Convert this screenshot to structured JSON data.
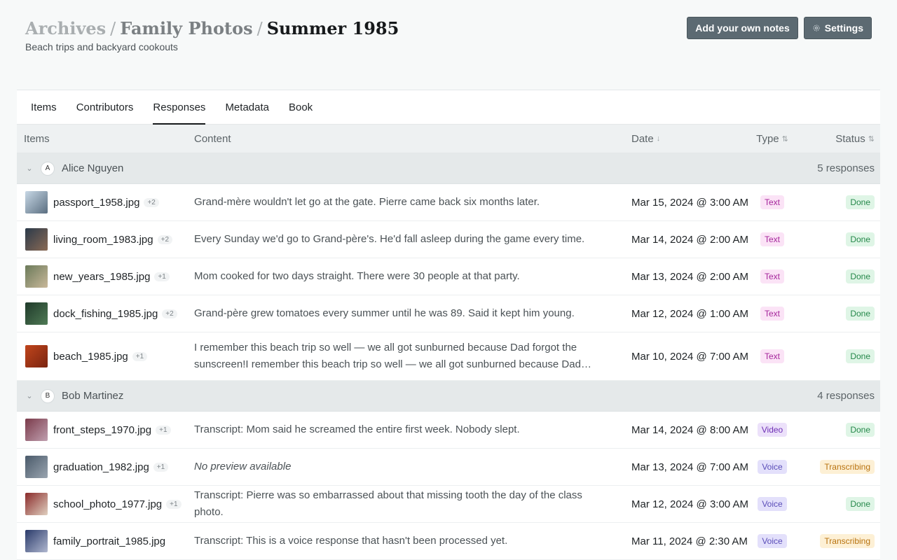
{
  "breadcrumb": {
    "level1": "Archives",
    "level2": "Family Photos",
    "level3": "Summer 1985",
    "separator": "/"
  },
  "subtitle": "Beach trips and backyard cookouts",
  "actions": {
    "notes_label": "Add your own notes",
    "settings_label": "Settings"
  },
  "tabs": [
    {
      "label": "Items",
      "active": false
    },
    {
      "label": "Contributors",
      "active": false
    },
    {
      "label": "Responses",
      "active": true
    },
    {
      "label": "Metadata",
      "active": false
    },
    {
      "label": "Book",
      "active": false
    }
  ],
  "columns": {
    "items": "Items",
    "content": "Content",
    "date": "Date",
    "type": "Type",
    "status": "Status"
  },
  "groups": [
    {
      "initial": "A",
      "name": "Alice Nguyen",
      "count": "5 responses",
      "rows": [
        {
          "file": "passport_1958.jpg",
          "extra": "+2",
          "content": "Grand-mère wouldn't let go at the gate. Pierre came back six months later.",
          "date": "Mar 15, 2024 @ 3:00 AM",
          "type": "Text",
          "status": "Done",
          "thumb": [
            "#c8d8e6",
            "#5a6e80"
          ]
        },
        {
          "file": "living_room_1983.jpg",
          "extra": "+2",
          "content": "Every Sunday we'd go to Grand-père's. He'd fall asleep during the game every time.",
          "date": "Mar 14, 2024 @ 2:00 AM",
          "type": "Text",
          "status": "Done",
          "thumb": [
            "#2b3a4a",
            "#8a6a55"
          ]
        },
        {
          "file": "new_years_1985.jpg",
          "extra": "+1",
          "content": "Mom cooked for two days straight. There were 30 people at that party.",
          "date": "Mar 13, 2024 @ 2:00 AM",
          "type": "Text",
          "status": "Done",
          "thumb": [
            "#6b7a5a",
            "#c9b89a"
          ]
        },
        {
          "file": "dock_fishing_1985.jpg",
          "extra": "+2",
          "content": "Grand-père grew tomatoes every summer until he was 89. Said it kept him young.",
          "date": "Mar 12, 2024 @ 1:00 AM",
          "type": "Text",
          "status": "Done",
          "thumb": [
            "#1f3a2a",
            "#4f7a55"
          ]
        },
        {
          "file": "beach_1985.jpg",
          "extra": "+1",
          "content": "I remember this beach trip so well — we all got sunburned because Dad forgot the sunscreen!I remember this beach trip so well — we all got sunburned because Dad forgot the sunscreen!",
          "date": "Mar 10, 2024 @ 7:00 AM",
          "type": "Text",
          "status": "Done",
          "thumb": [
            "#c0451c",
            "#7a2410"
          ],
          "tall": true
        }
      ]
    },
    {
      "initial": "B",
      "name": "Bob Martinez",
      "count": "4 responses",
      "rows": [
        {
          "file": "front_steps_1970.jpg",
          "extra": "+1",
          "content": "Transcript: Mom said he screamed the entire first week. Nobody slept.",
          "date": "Mar 14, 2024 @ 8:00 AM",
          "type": "Video",
          "status": "Done",
          "thumb": [
            "#7a3a4a",
            "#c0a0b0"
          ]
        },
        {
          "file": "graduation_1982.jpg",
          "extra": "+1",
          "content": "No preview available",
          "italic": true,
          "date": "Mar 13, 2024 @ 7:00 AM",
          "type": "Voice",
          "status": "Transcribing",
          "thumb": [
            "#4a5a6a",
            "#9aa5b0"
          ]
        },
        {
          "file": "school_photo_1977.jpg",
          "extra": "+1",
          "content": "Transcript: Pierre was so embarrassed about that missing tooth the day of the class photo.",
          "date": "Mar 12, 2024 @ 3:00 AM",
          "type": "Voice",
          "status": "Done",
          "thumb": [
            "#8a2a2a",
            "#e0d0c0"
          ]
        },
        {
          "file": "family_portrait_1985.jpg",
          "extra": "",
          "content": "Transcript: This is a voice response that hasn't been processed yet.",
          "date": "Mar 11, 2024 @ 2:30 AM",
          "type": "Voice",
          "status": "Transcribing",
          "thumb": [
            "#2a3a6a",
            "#b0b8d0"
          ]
        }
      ]
    }
  ],
  "icons": {
    "settings": "gear-icon",
    "collapse": "chevron-down-icon",
    "sort_desc": "arrow-down-icon",
    "sort_both": "sort-icon"
  },
  "colors": {
    "button_bg": "#5c6a72",
    "done": "#25884a",
    "transcribing": "#b8720e",
    "text_type": "#a5259b",
    "voice_type": "#5a4db8",
    "video_type": "#6e2fb5"
  }
}
